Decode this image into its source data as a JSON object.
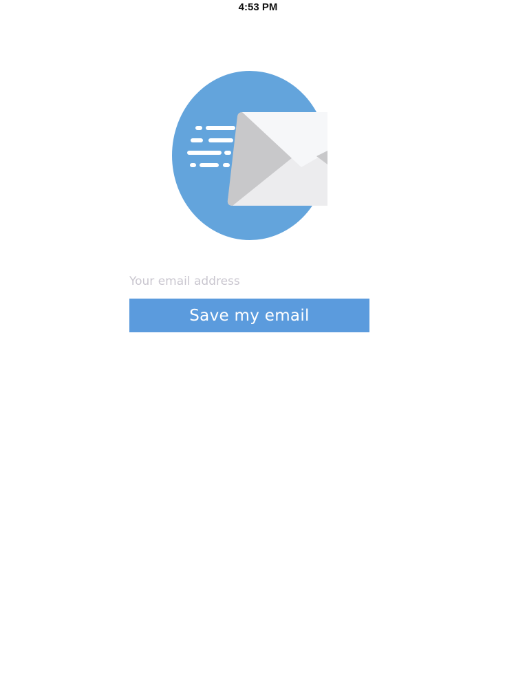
{
  "status_bar": {
    "time": "4:53 PM"
  },
  "hero": {
    "icon": "envelope-icon",
    "circle_color": "#63a4dc"
  },
  "form": {
    "email_placeholder": "Your email address",
    "email_value": "",
    "save_label": "Save my email",
    "button_color": "#5b9bdd"
  }
}
